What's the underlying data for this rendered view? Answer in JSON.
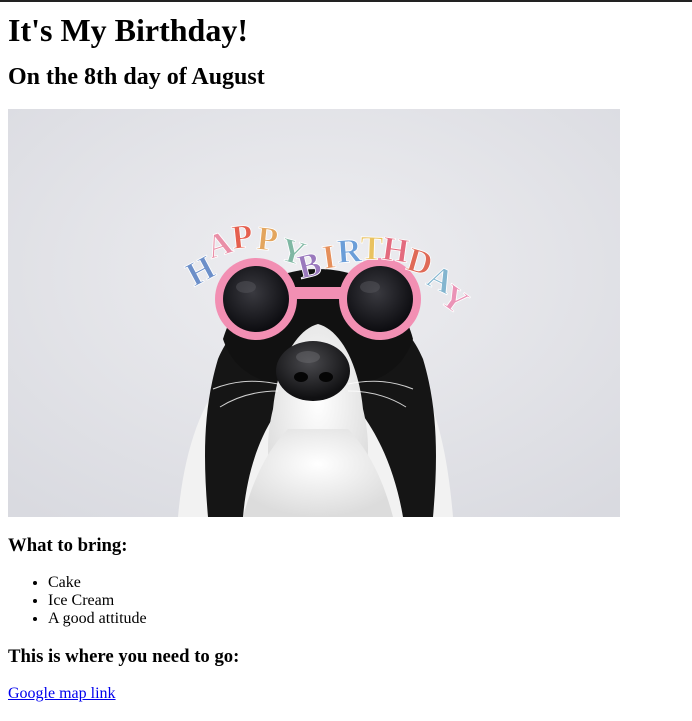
{
  "heading": "It's My Birthday!",
  "subheading": "On the 8th day of August",
  "photo": {
    "alt": "Dog wearing Happy Birthday glasses",
    "glasses_text": "HAPPY BIRTHDAY"
  },
  "bring": {
    "title": "What to bring:",
    "items": [
      "Cake",
      "Ice Cream",
      "A good attitude"
    ]
  },
  "location": {
    "title": "This is where you need to go:",
    "link_text": "Google map link"
  }
}
